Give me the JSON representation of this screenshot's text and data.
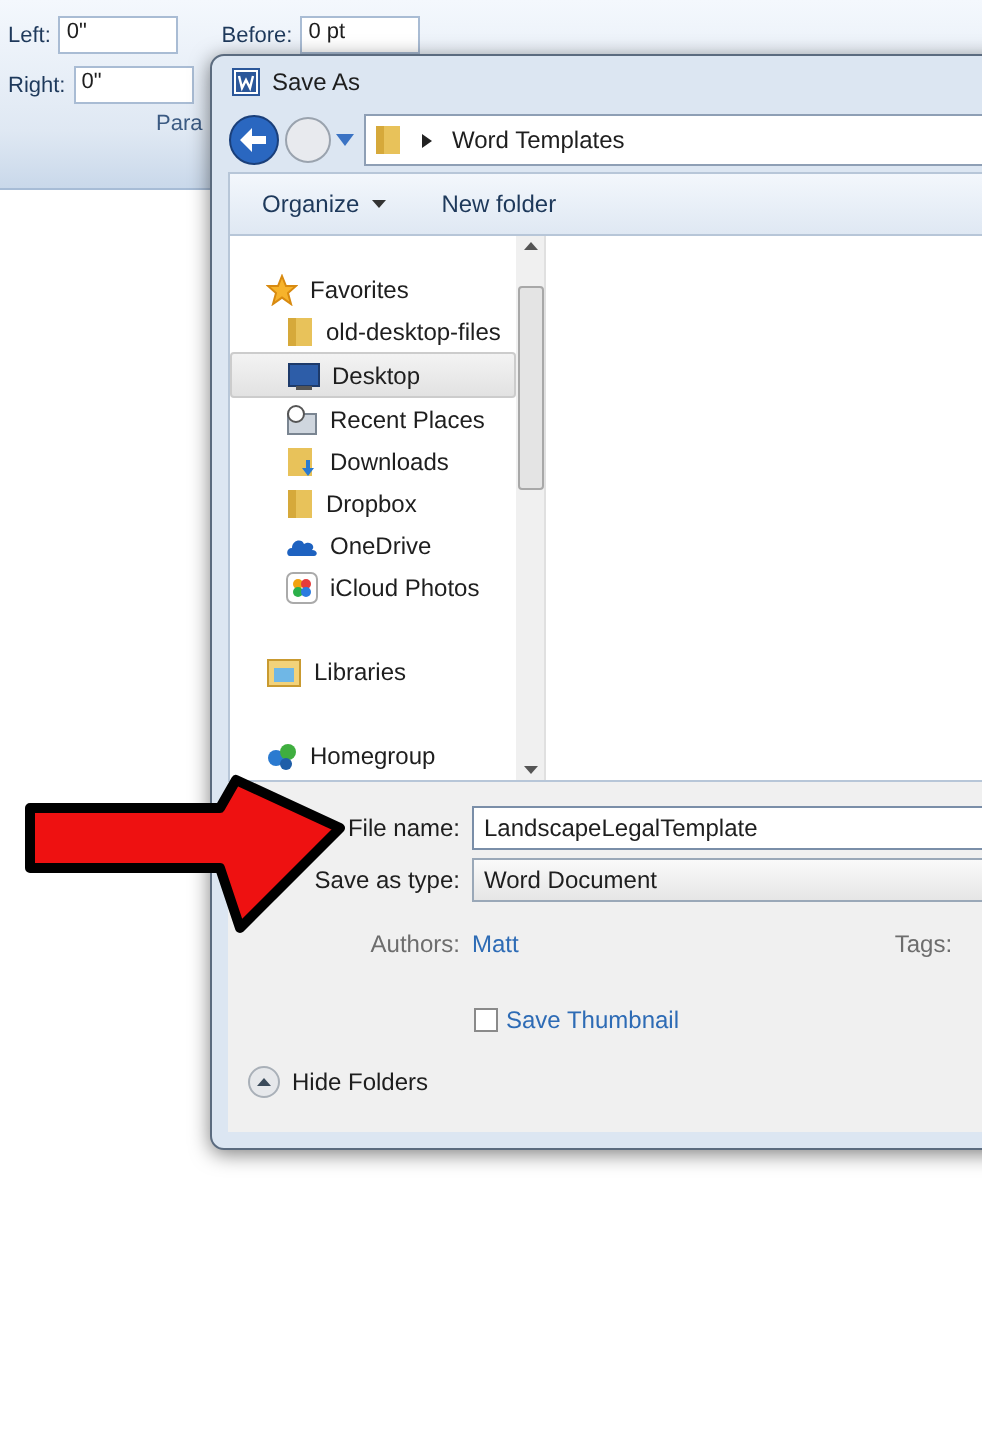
{
  "ribbon": {
    "indent": [
      {
        "label": "Left:",
        "value": "0\""
      },
      {
        "label": "Right:",
        "value": "0\""
      }
    ],
    "spacing": [
      {
        "label": "Before:",
        "value": "0 pt"
      }
    ],
    "group_label": "Para"
  },
  "dialog": {
    "title": "Save As",
    "address": "Word Templates",
    "toolbar": [
      "Organize",
      "New folder"
    ],
    "nav": [
      {
        "label": "Favorites",
        "kind": "group",
        "selected": false
      },
      {
        "label": "old-desktop-files",
        "kind": "folder",
        "selected": false
      },
      {
        "label": "Desktop",
        "kind": "desktop",
        "selected": true
      },
      {
        "label": "Recent Places",
        "kind": "recent",
        "selected": false
      },
      {
        "label": "Downloads",
        "kind": "downloads",
        "selected": false
      },
      {
        "label": "Dropbox",
        "kind": "folder",
        "selected": false
      },
      {
        "label": "OneDrive",
        "kind": "cloud",
        "selected": false
      },
      {
        "label": "iCloud Photos",
        "kind": "photos",
        "selected": false
      },
      {
        "label": "Libraries",
        "kind": "libraries",
        "selected": false
      },
      {
        "label": "Homegroup",
        "kind": "homegroup",
        "selected": false
      }
    ],
    "file_name": {
      "label": "File name:",
      "value": "LandscapeLegalTemplate"
    },
    "save_as_type": {
      "label": "Save as type:",
      "value": "Word Document"
    },
    "authors": {
      "label": "Authors:",
      "value": "Matt"
    },
    "tags": {
      "label": "Tags:"
    },
    "save_thumbnail": {
      "label": "Save Thumbnail",
      "checked": false
    },
    "hide_folders": "Hide Folders"
  }
}
